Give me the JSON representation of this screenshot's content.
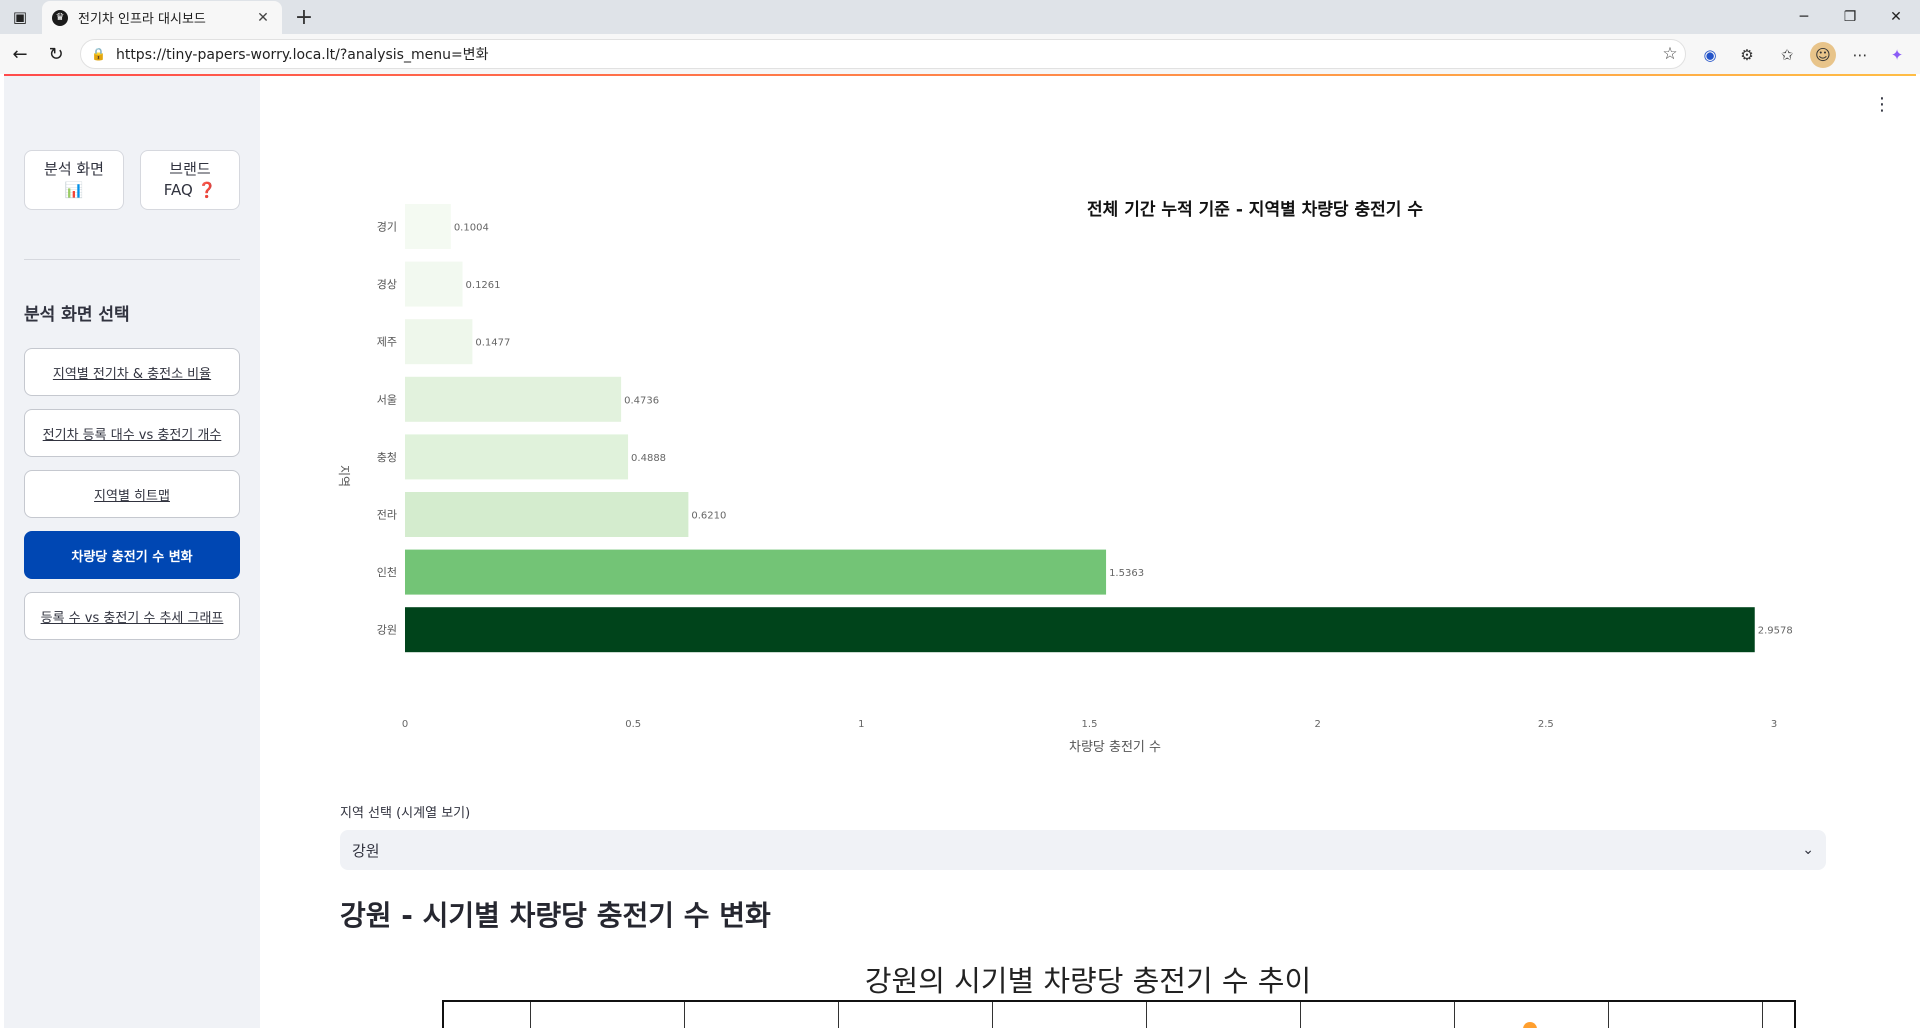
{
  "browser": {
    "tab_title": "전기차 인프라 대시보드",
    "url": "https://tiny-papers-worry.loca.lt/?analysis_menu=변화"
  },
  "sidebar": {
    "top_buttons": [
      {
        "line1": "분석 화면",
        "line2": "📊"
      },
      {
        "line1": "브랜드",
        "line2": "FAQ ❓"
      }
    ],
    "heading": "분석 화면 선택",
    "nav": [
      {
        "label": "지역별 전기차 & 충전소 비율",
        "active": false
      },
      {
        "label": "전기차 등록 대수 vs 충전기 개수",
        "active": false
      },
      {
        "label": "지역별 히트맵",
        "active": false
      },
      {
        "label": "차량당 충전기 수 변화",
        "active": true
      },
      {
        "label": "등록 수 vs 충전기 수 추세 그래프",
        "active": false
      }
    ]
  },
  "chart_data": {
    "type": "bar",
    "orientation": "horizontal",
    "title": "전체 기간 누적 기준 - 지역별 차량당 충전기 수",
    "xlabel": "차량당 충전기 수",
    "ylabel": "지역",
    "categories": [
      "경기",
      "경상",
      "제주",
      "서울",
      "충청",
      "전라",
      "인천",
      "강원"
    ],
    "values": [
      0.1004,
      0.1261,
      0.1477,
      0.4736,
      0.4888,
      0.621,
      1.5363,
      2.9578
    ],
    "value_labels": [
      "0.1004",
      "0.1261",
      "0.1477",
      "0.4736",
      "0.4888",
      "0.6210",
      "1.5363",
      "2.9578"
    ],
    "colors": [
      "#f4faf2",
      "#f2f9f0",
      "#eef7eb",
      "#e2f2dd",
      "#e0f2db",
      "#d4ecce",
      "#73c476",
      "#00441b"
    ],
    "xlim": [
      0,
      3
    ],
    "xticks": [
      "0",
      "0.5",
      "1",
      "1.5",
      "2",
      "2.5",
      "3"
    ],
    "grid": false
  },
  "main": {
    "kebab": "⋮",
    "select_label": "지역 선택 (시계열 보기)",
    "select_value": "강원",
    "section_title": "강원 - 시기별 차량당 충전기 수 변화",
    "sub_chart_title": "강원의 시기별 차량당 충전기 수 추이"
  }
}
